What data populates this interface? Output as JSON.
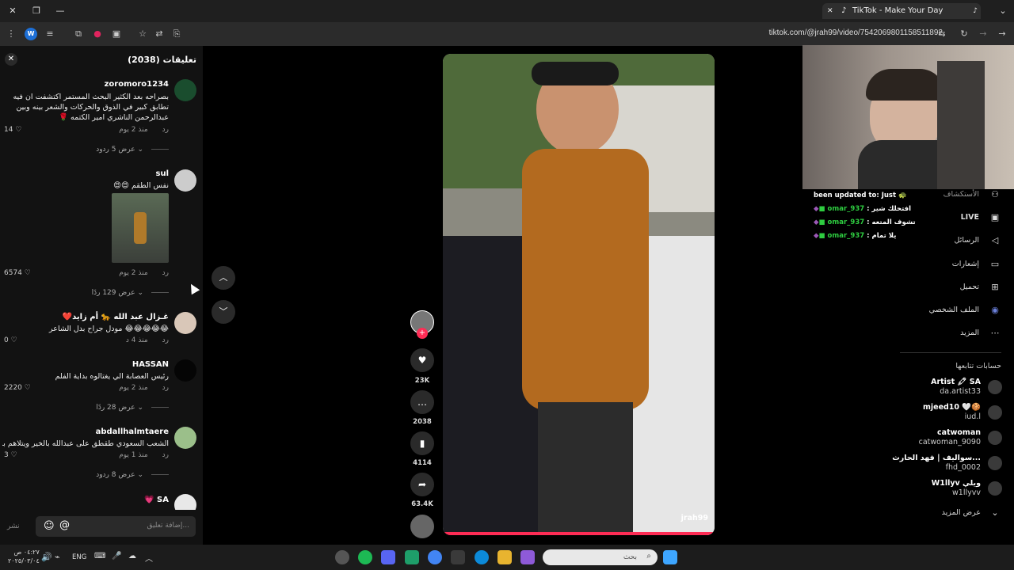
{
  "browser": {
    "tab_title": "TikTok - Make Your Day",
    "url": "tiktok.com/@jrah99/video/7542069801158511892"
  },
  "comments_panel": {
    "title": "تعليقات (2038)",
    "comments": [
      {
        "user": "zoromoro1234",
        "text": "بصراحه بعد الكثير البحث المستمر اكتشفت ان فيه تطابق كبير في الذوق والحركات والشعر بينه وبين عبدالرحمن الناشري امير الكتمه 🌹",
        "time": "منذ 2 يوم",
        "reply": "رد",
        "likes": "14",
        "view_replies": "عرض 5 ردود"
      },
      {
        "user": "sul",
        "text": "نفس الطقم 😍😍",
        "time": "منذ 2 يوم",
        "reply": "رد",
        "likes": "6574",
        "view_replies": "عرض 129 ردًا"
      },
      {
        "user": "غـزال عبد الله 🐆 أم زايد❤️",
        "text": "😂😂😂😂😂 مودل جراح بدل الشاعر",
        "time": "منذ 4 د",
        "reply": "رد",
        "likes": "0",
        "view_replies": ""
      },
      {
        "user": "HASSAN",
        "text": "رئيس العصابة الي يغتالوه بداية الفلم",
        "time": "منذ 2 يوم",
        "reply": "رد",
        "likes": "2220",
        "view_replies": "عرض 28 ردًا"
      },
      {
        "user": "abdallhalmtaere",
        "text": "الشعب السعودي طقطق على عبدالله بالخير ويتلاهم بذ",
        "time": "منذ 1 يوم",
        "reply": "رد",
        "likes": "3",
        "view_replies": "عرض 8 ردود"
      },
      {
        "user": "💗 SA",
        "text": "",
        "time": "",
        "reply": "",
        "likes": "",
        "view_replies": ""
      }
    ],
    "input_placeholder": "إضافة تعليق...",
    "post_label": "نشر"
  },
  "video": {
    "watermark": "jrah99",
    "likes": "23K",
    "comments": "2038",
    "saves": "4114",
    "shares": "63.4K"
  },
  "stream_chat": {
    "notice": "been updated to: Just 🐢",
    "lines": [
      {
        "user": "omar_937",
        "msg": ": افتحلك شير"
      },
      {
        "user": "omar_937",
        "msg": ": تشوف المتعه"
      },
      {
        "user": "omar_937",
        "msg": ": يلا تمام"
      }
    ]
  },
  "right_nav": {
    "items": [
      {
        "label": "الأستكشاف",
        "icon": "friends-icon"
      },
      {
        "label": "LIVE",
        "icon": "live-icon"
      },
      {
        "label": "الرسائل",
        "icon": "send-icon"
      },
      {
        "label": "إشعارات",
        "icon": "notifications-icon"
      },
      {
        "label": "تحميل",
        "icon": "upload-icon"
      },
      {
        "label": "الملف الشخصي",
        "icon": "profile-icon"
      },
      {
        "label": "المزيد",
        "icon": "more-icon"
      }
    ],
    "following_title": "حسابات تتابعها",
    "following": [
      {
        "name": "Artist 🖍 SA",
        "handle": "da.artist33"
      },
      {
        "name": "mjeed10 🤍🍪",
        "handle": "iud.l"
      },
      {
        "name": "catwoman",
        "handle": "catwoman_9090"
      },
      {
        "name": "سواليف | فهد الحارث...",
        "handle": "fhd_0002"
      },
      {
        "name": "W1llyv ويلي",
        "handle": "w1llyvv"
      }
    ],
    "see_more": "عرض المزيد"
  },
  "taskbar": {
    "time": "٠٤:٢٧ ص",
    "date": "٢٠٢٥/٠٣/٠٤",
    "lang": "ENG",
    "search_placeholder": "بحث"
  }
}
